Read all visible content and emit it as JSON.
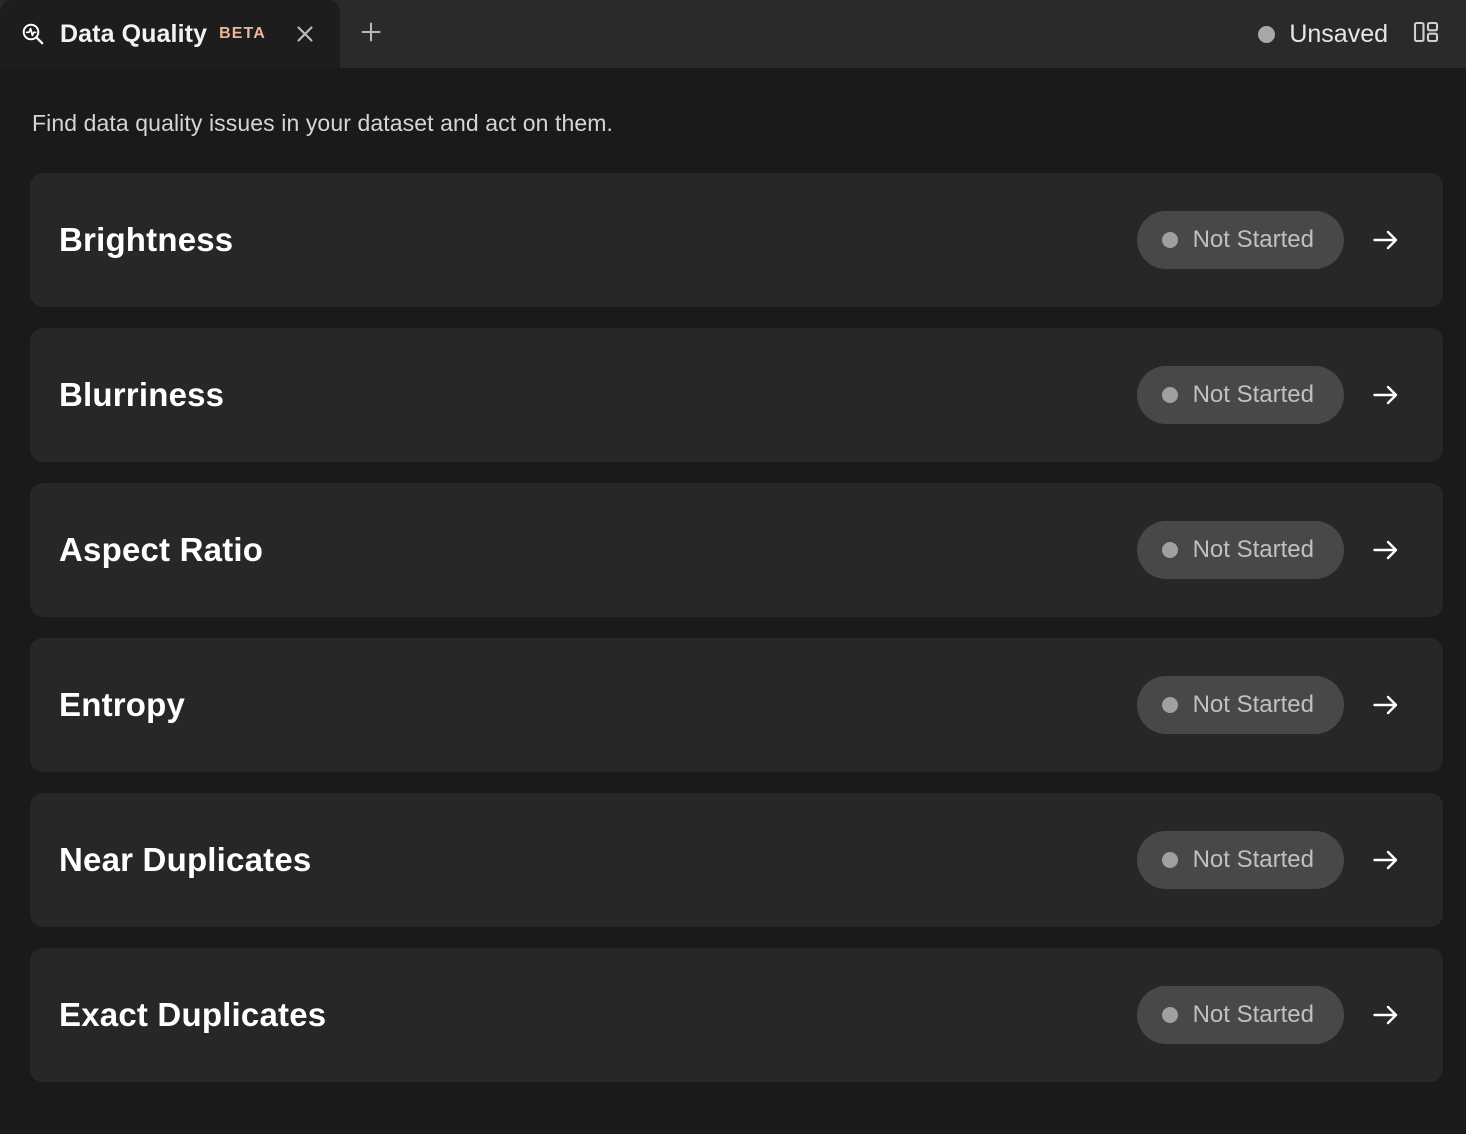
{
  "window": {
    "tabs": [
      {
        "icon": "data-quality-magnifier-icon",
        "title": "Data Quality",
        "badge": "BETA",
        "close_icon": "close-icon",
        "active": true
      }
    ],
    "new_tab_icon": "plus-icon",
    "save_status": {
      "label": "Unsaved",
      "dot_color": "#a8a8a8"
    },
    "layout_toggle_icon": "layout-panels-icon"
  },
  "page": {
    "subtitle": "Find data quality issues in your dataset and act on them.",
    "issues": [
      {
        "title": "Brightness",
        "status": "Not Started",
        "arrow_icon": "arrow-right-icon"
      },
      {
        "title": "Blurriness",
        "status": "Not Started",
        "arrow_icon": "arrow-right-icon"
      },
      {
        "title": "Aspect Ratio",
        "status": "Not Started",
        "arrow_icon": "arrow-right-icon"
      },
      {
        "title": "Entropy",
        "status": "Not Started",
        "arrow_icon": "arrow-right-icon"
      },
      {
        "title": "Near Duplicates",
        "status": "Not Started",
        "arrow_icon": "arrow-right-icon"
      },
      {
        "title": "Exact Duplicates",
        "status": "Not Started",
        "arrow_icon": "arrow-right-icon"
      }
    ]
  },
  "colors": {
    "background": "#1a1a1a",
    "tabbar": "#2b2a29",
    "active_tab": "#1d1d1d",
    "row": "#272726",
    "pill": "#484848",
    "beta_accent": "#e9b89a",
    "status_dot": "#a0a0a0"
  }
}
